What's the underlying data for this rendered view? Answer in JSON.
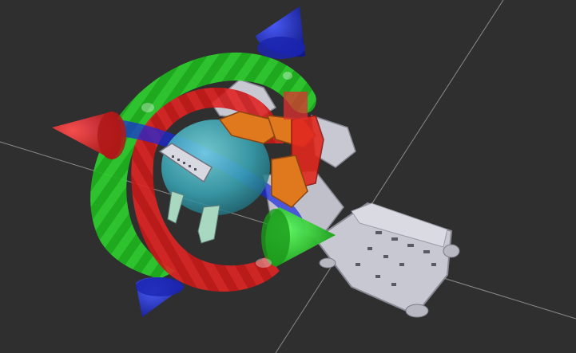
{
  "viewport": {
    "background_color": "#2f2f2f",
    "grid_line_color": "#9a9a9a",
    "grid_visible": true
  },
  "robot": {
    "base_color": "#c8c8d2",
    "arm_orange_color": "#e0781e",
    "arm_red_color": "#e0281e",
    "gripper_head_color": "#40b0c0"
  },
  "interactive_marker": {
    "x_axis_color": "#e01a1a",
    "y_axis_color": "#19c819",
    "z_axis_color": "#1a2ae0",
    "rotation_ring_names": [
      "red-ring",
      "green-ring",
      "blue-ring"
    ],
    "translation_arrow_names": [
      "red-arrow-left",
      "green-arrow-right",
      "blue-arrow-up",
      "blue-arrow-down"
    ],
    "icons": [
      "move-arrow-icon",
      "rotate-ring-icon"
    ]
  }
}
